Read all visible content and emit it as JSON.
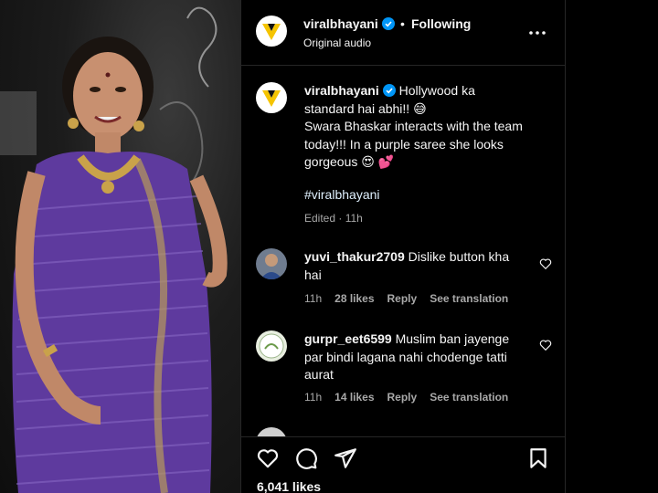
{
  "post": {
    "username": "viralbhayani",
    "separator": "•",
    "follow_status": "Following",
    "audio": "Original audio",
    "caption_lines": [
      "Hollywood ka",
      "standard hai abhi!! 😅",
      "Swara Bhaskar interacts with the team",
      "today!!! In a purple saree she looks",
      "gorgeous 😍 💕"
    ],
    "hashtag": "#viralbhayani",
    "edited": "Edited · 11h",
    "likes": "6,041 likes"
  },
  "comments": [
    {
      "username": "yuvi_thakur2709",
      "text": "Dislike button kha hai",
      "time": "11h",
      "likes": "28 likes",
      "reply": "Reply",
      "translate": "See translation"
    },
    {
      "username": "gurpr_eet6599",
      "text": "Muslim ban jayenge par bindi lagana nahi chodenge tatti aurat",
      "time": "11h",
      "likes": "14 likes",
      "reply": "Reply",
      "translate": "See translation"
    }
  ],
  "icons": {
    "verified": "verified-badge-icon",
    "more": "more-options-icon",
    "like": "heart-icon",
    "comment": "comment-icon",
    "share": "share-icon",
    "save": "bookmark-icon"
  },
  "colors": {
    "accent_verified": "#0095f6",
    "logo_yellow": "#f5c400",
    "saree_purple": "#5e3a9e"
  }
}
